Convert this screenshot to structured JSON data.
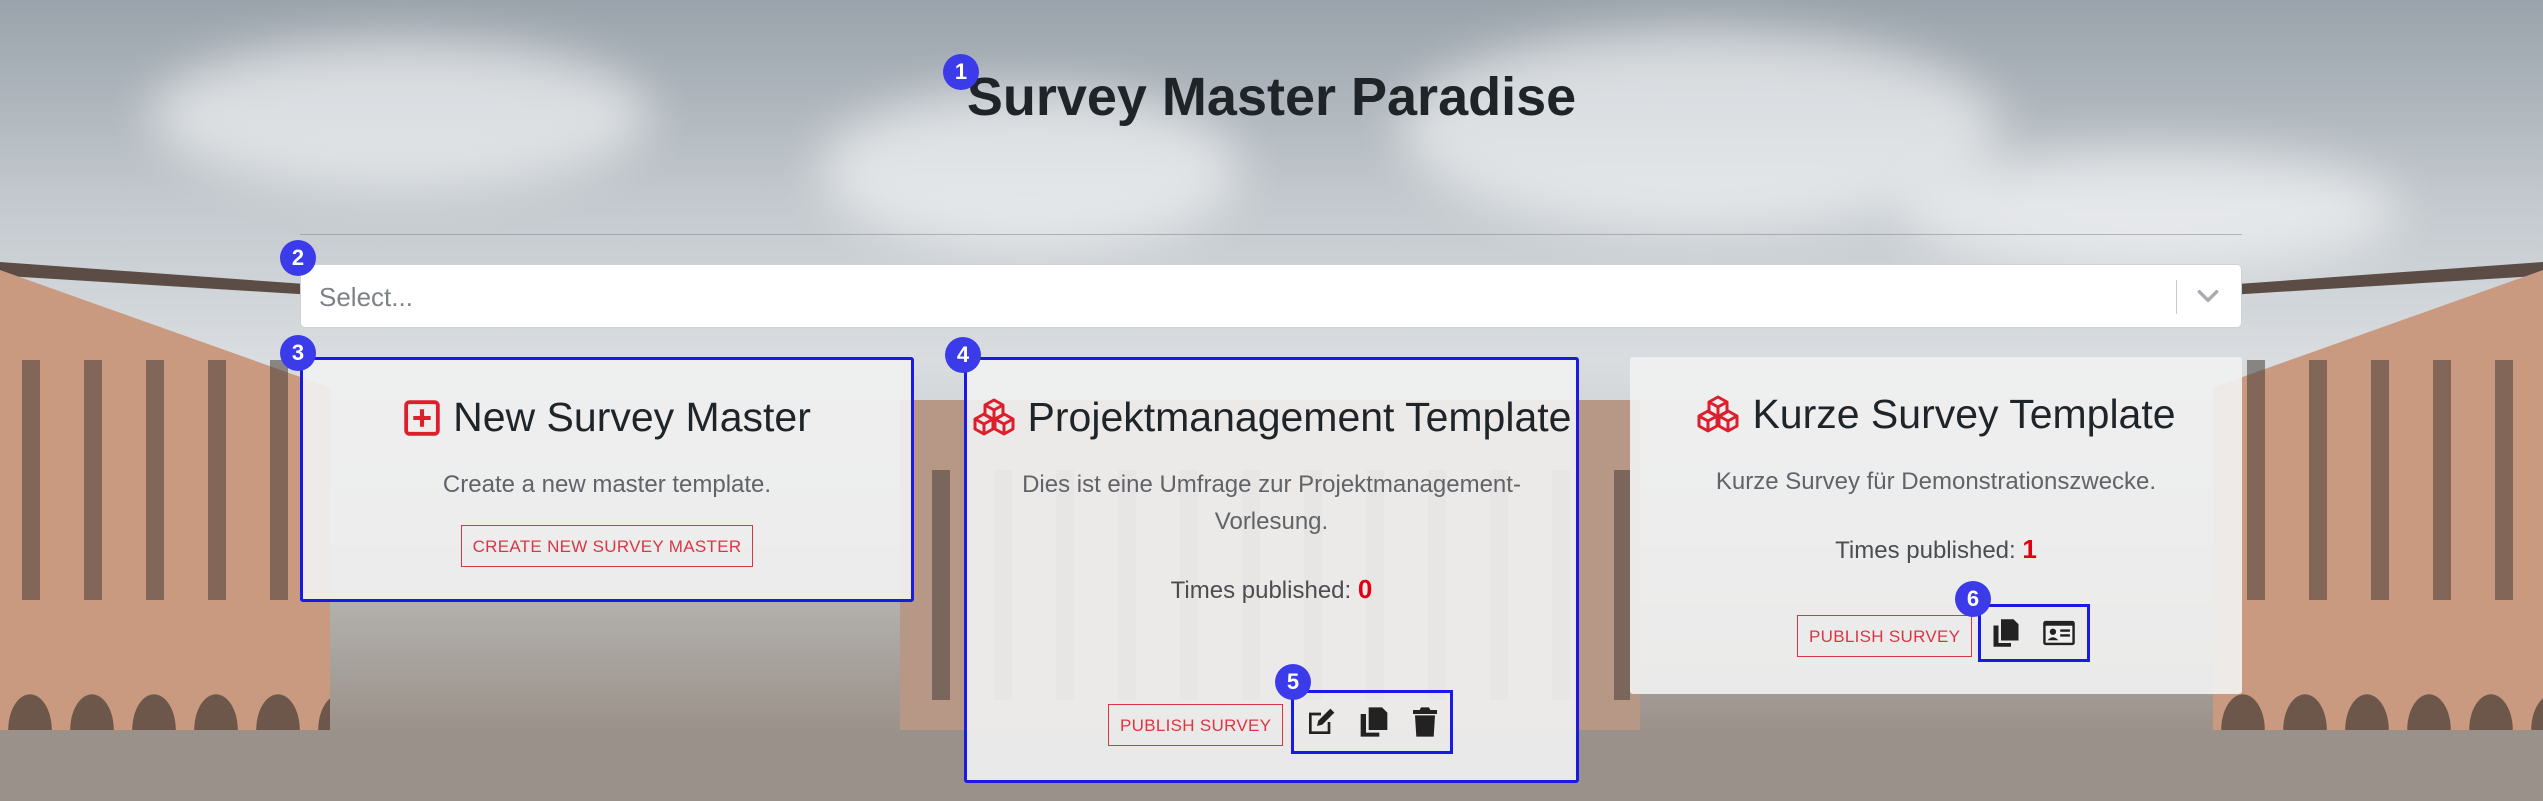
{
  "page": {
    "title": "Survey Master Paradise"
  },
  "search": {
    "placeholder": "Select..."
  },
  "cards": {
    "new_master": {
      "title": "New Survey Master",
      "description": "Create a new master template.",
      "button": "CREATE NEW SURVEY MASTER",
      "icon": "plus-square-icon"
    },
    "projektmanagement": {
      "title": "Projektmanagement Template",
      "description_line1": "Dies ist eine Umfrage zur Projektmanagement-",
      "description_line2": "Vorlesung.",
      "times_label": "Times published:",
      "times_value": "0",
      "button": "PUBLISH SURVEY",
      "icons": [
        "edit-icon",
        "copy-icon",
        "trash-icon"
      ]
    },
    "kurze": {
      "title": "Kurze Survey Template",
      "description": "Kurze Survey für Demonstrationszwecke.",
      "times_label": "Times published:",
      "times_value": "1",
      "button": "PUBLISH SURVEY",
      "icons": [
        "copy-icon",
        "id-card-icon"
      ]
    }
  },
  "badges": [
    "1",
    "2",
    "3",
    "4",
    "5",
    "6"
  ],
  "colors": {
    "accent_red": "#dc3545",
    "highlight_blue": "#1a1ae6",
    "badge_blue": "#3b3bea"
  }
}
